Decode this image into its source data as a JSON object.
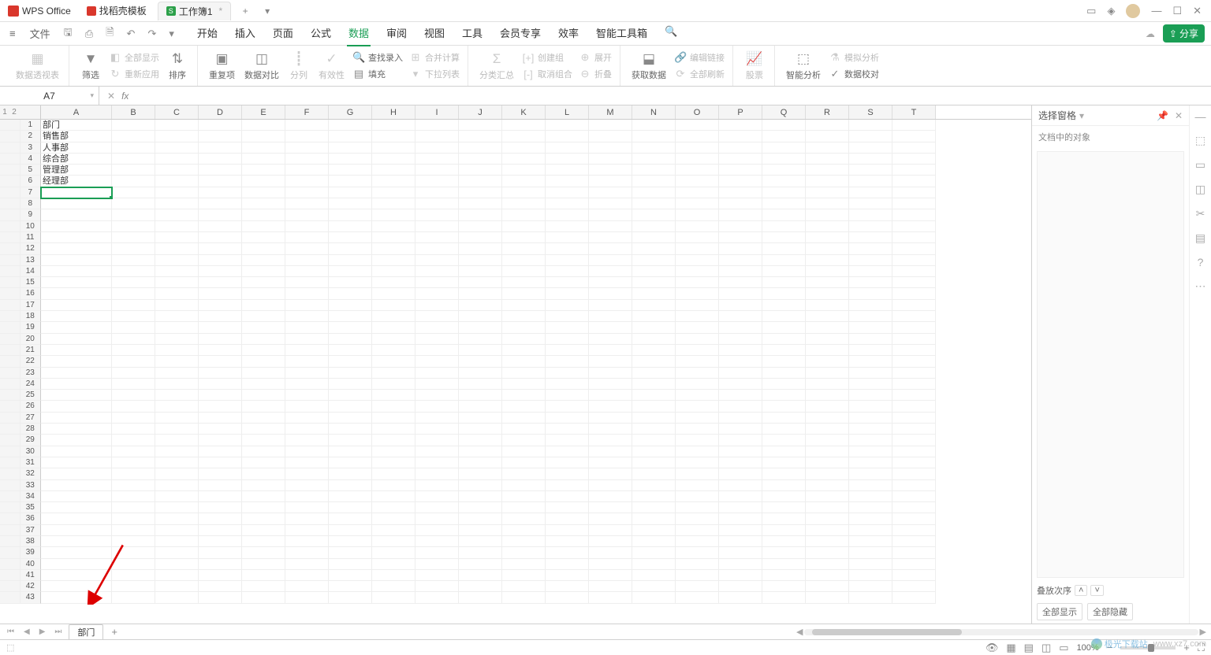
{
  "app": {
    "name": "WPS Office"
  },
  "tabs": [
    {
      "icon": "d",
      "label": "找稻壳模板"
    },
    {
      "icon": "s",
      "label": "工作簿1",
      "active": true,
      "modified": "*"
    }
  ],
  "title_right": {
    "add": "+"
  },
  "menu": {
    "file": "文件",
    "items": [
      "开始",
      "插入",
      "页面",
      "公式",
      "数据",
      "审阅",
      "视图",
      "工具",
      "会员专享",
      "效率",
      "智能工具箱"
    ],
    "active_index": 4,
    "share": "分享"
  },
  "ribbon": {
    "pivot": "数据透视表",
    "filter": "筛选",
    "show_all": "全部显示",
    "reapply": "重新应用",
    "sort": "排序",
    "dup": "重复项",
    "compare": "数据对比",
    "split": "分列",
    "validity": "有效性",
    "find_entry": "查找录入",
    "fill": "填充",
    "merge_calc": "合并计算",
    "dropdown": "下拉列表",
    "subtotal": "分类汇总",
    "group": "创建组",
    "ungroup": "取消组合",
    "expand": "展开",
    "collapse": "折叠",
    "get_data": "获取数据",
    "edit_link": "编辑链接",
    "refresh_all": "全部刷新",
    "stock": "股票",
    "smart_analyze": "智能分析",
    "mock": "模拟分析",
    "data_check": "数据校对"
  },
  "formula_bar": {
    "name_box": "A7",
    "fx": "fx"
  },
  "columns": [
    "A",
    "B",
    "C",
    "D",
    "E",
    "F",
    "G",
    "H",
    "I",
    "J",
    "K",
    "L",
    "M",
    "N",
    "O",
    "P",
    "Q",
    "R",
    "S",
    "T"
  ],
  "outline_cols": [
    "1",
    "2"
  ],
  "rows_count": 43,
  "cell_data": {
    "1": {
      "A": "部门"
    },
    "2": {
      "A": "销售部"
    },
    "3": {
      "A": "人事部"
    },
    "4": {
      "A": "综合部"
    },
    "5": {
      "A": "管理部"
    },
    "6": {
      "A": "经理部"
    }
  },
  "selected": "A7",
  "side_panel": {
    "title": "选择窗格",
    "sub": "文档中的对象",
    "stack_order": "叠放次序",
    "show_all": "全部显示",
    "hide_all": "全部隐藏"
  },
  "sheet_bar": {
    "sheet_name": "部门"
  },
  "status": {
    "zoom": "100%"
  },
  "watermark": {
    "site": "极光下载站",
    "url": "www.xz7.com"
  }
}
